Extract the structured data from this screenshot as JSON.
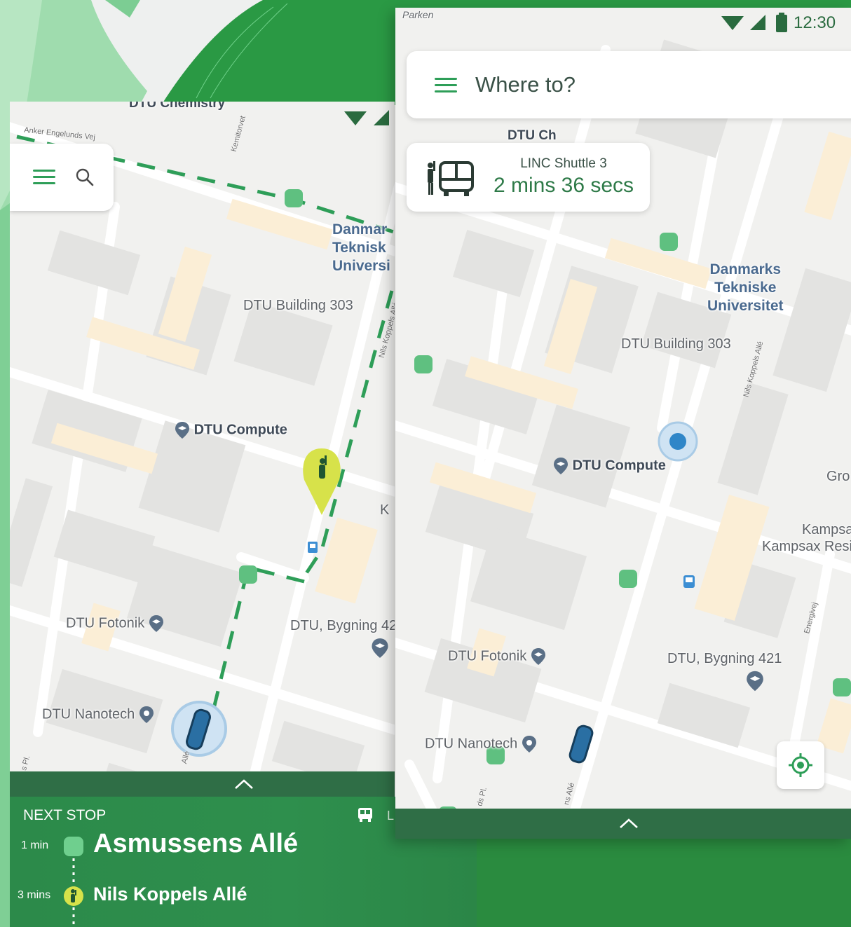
{
  "colors": {
    "accent_green": "#2e9e58",
    "sheet_green": "#2c8a4a",
    "sheet_handle": "#2f6e46",
    "route_dash": "#2e9e58",
    "stop_marker": "#5fc080",
    "waiting_pin": "#d7e24a",
    "bus_blue": "#2a6fa3",
    "location_blue": "#2f86c8"
  },
  "left_phone": {
    "search_bar": {
      "menu_icon": "hamburger-icon",
      "search_icon": "search-icon"
    },
    "map_labels": {
      "chemistry": "DTU Chemistry",
      "street_top": "Anker Engelunds Vej",
      "kemitorvet": "Kemitorvet",
      "campus": [
        "Danmar",
        "Teknisk",
        "Universi"
      ],
      "building_303": "DTU Building 303",
      "nils_koppels": "Nils Koppels Allé",
      "compute": "DTU Compute",
      "fotonik": "DTU Fotonik",
      "bygning": "DTU, Bygning 42",
      "nanotech": "DTU Nanotech",
      "k_fragment": "K",
      "allé_fragment": "Allé",
      "pl_fragment": "s Pl."
    },
    "bottom_sheet": {
      "expand_icon": "chevron-up-icon",
      "heading": "NEXT STOP",
      "bus_icon": "bus-icon",
      "bus_line_fragment": "L",
      "stops": [
        {
          "eta": "1 min",
          "name": "Asmussens Allé",
          "marker": "stop-marker-icon"
        },
        {
          "eta": "3 mins",
          "name": "Nils Koppels Allé",
          "marker": "waiting-person-icon"
        }
      ]
    }
  },
  "right_phone": {
    "status_bar": {
      "time": "12:30",
      "icons": [
        "wifi-icon",
        "signal-icon",
        "battery-icon"
      ]
    },
    "search": {
      "menu_icon": "hamburger-icon",
      "placeholder": "Where to?"
    },
    "eta_card": {
      "icon": "person-bus-icon",
      "line": "LINC Shuttle 3",
      "eta": "2 mins 36 secs"
    },
    "map_labels": {
      "parken": "Parken",
      "campus": [
        "Danmarks",
        "Tekniske",
        "Universitet"
      ],
      "building_303": "DTU Building 303",
      "nils_koppels": "Nils Koppels Allé",
      "compute": "DTU Compute",
      "gro": "Gro",
      "kampsax_1": "Kampsa",
      "kampsax_2": "Kampsax Resi",
      "energivej": "Energivej",
      "fotonik": "DTU Fotonik",
      "bygning": "DTU, Bygning 421",
      "nanotech": "DTU Nanotech",
      "pl_fragment": "ds Pl.",
      "alle_fragment": "ns Allé",
      "chem_fragment": "DTU Ch"
    },
    "locate_button_icon": "my-location-icon",
    "expand_icon": "chevron-up-icon"
  }
}
